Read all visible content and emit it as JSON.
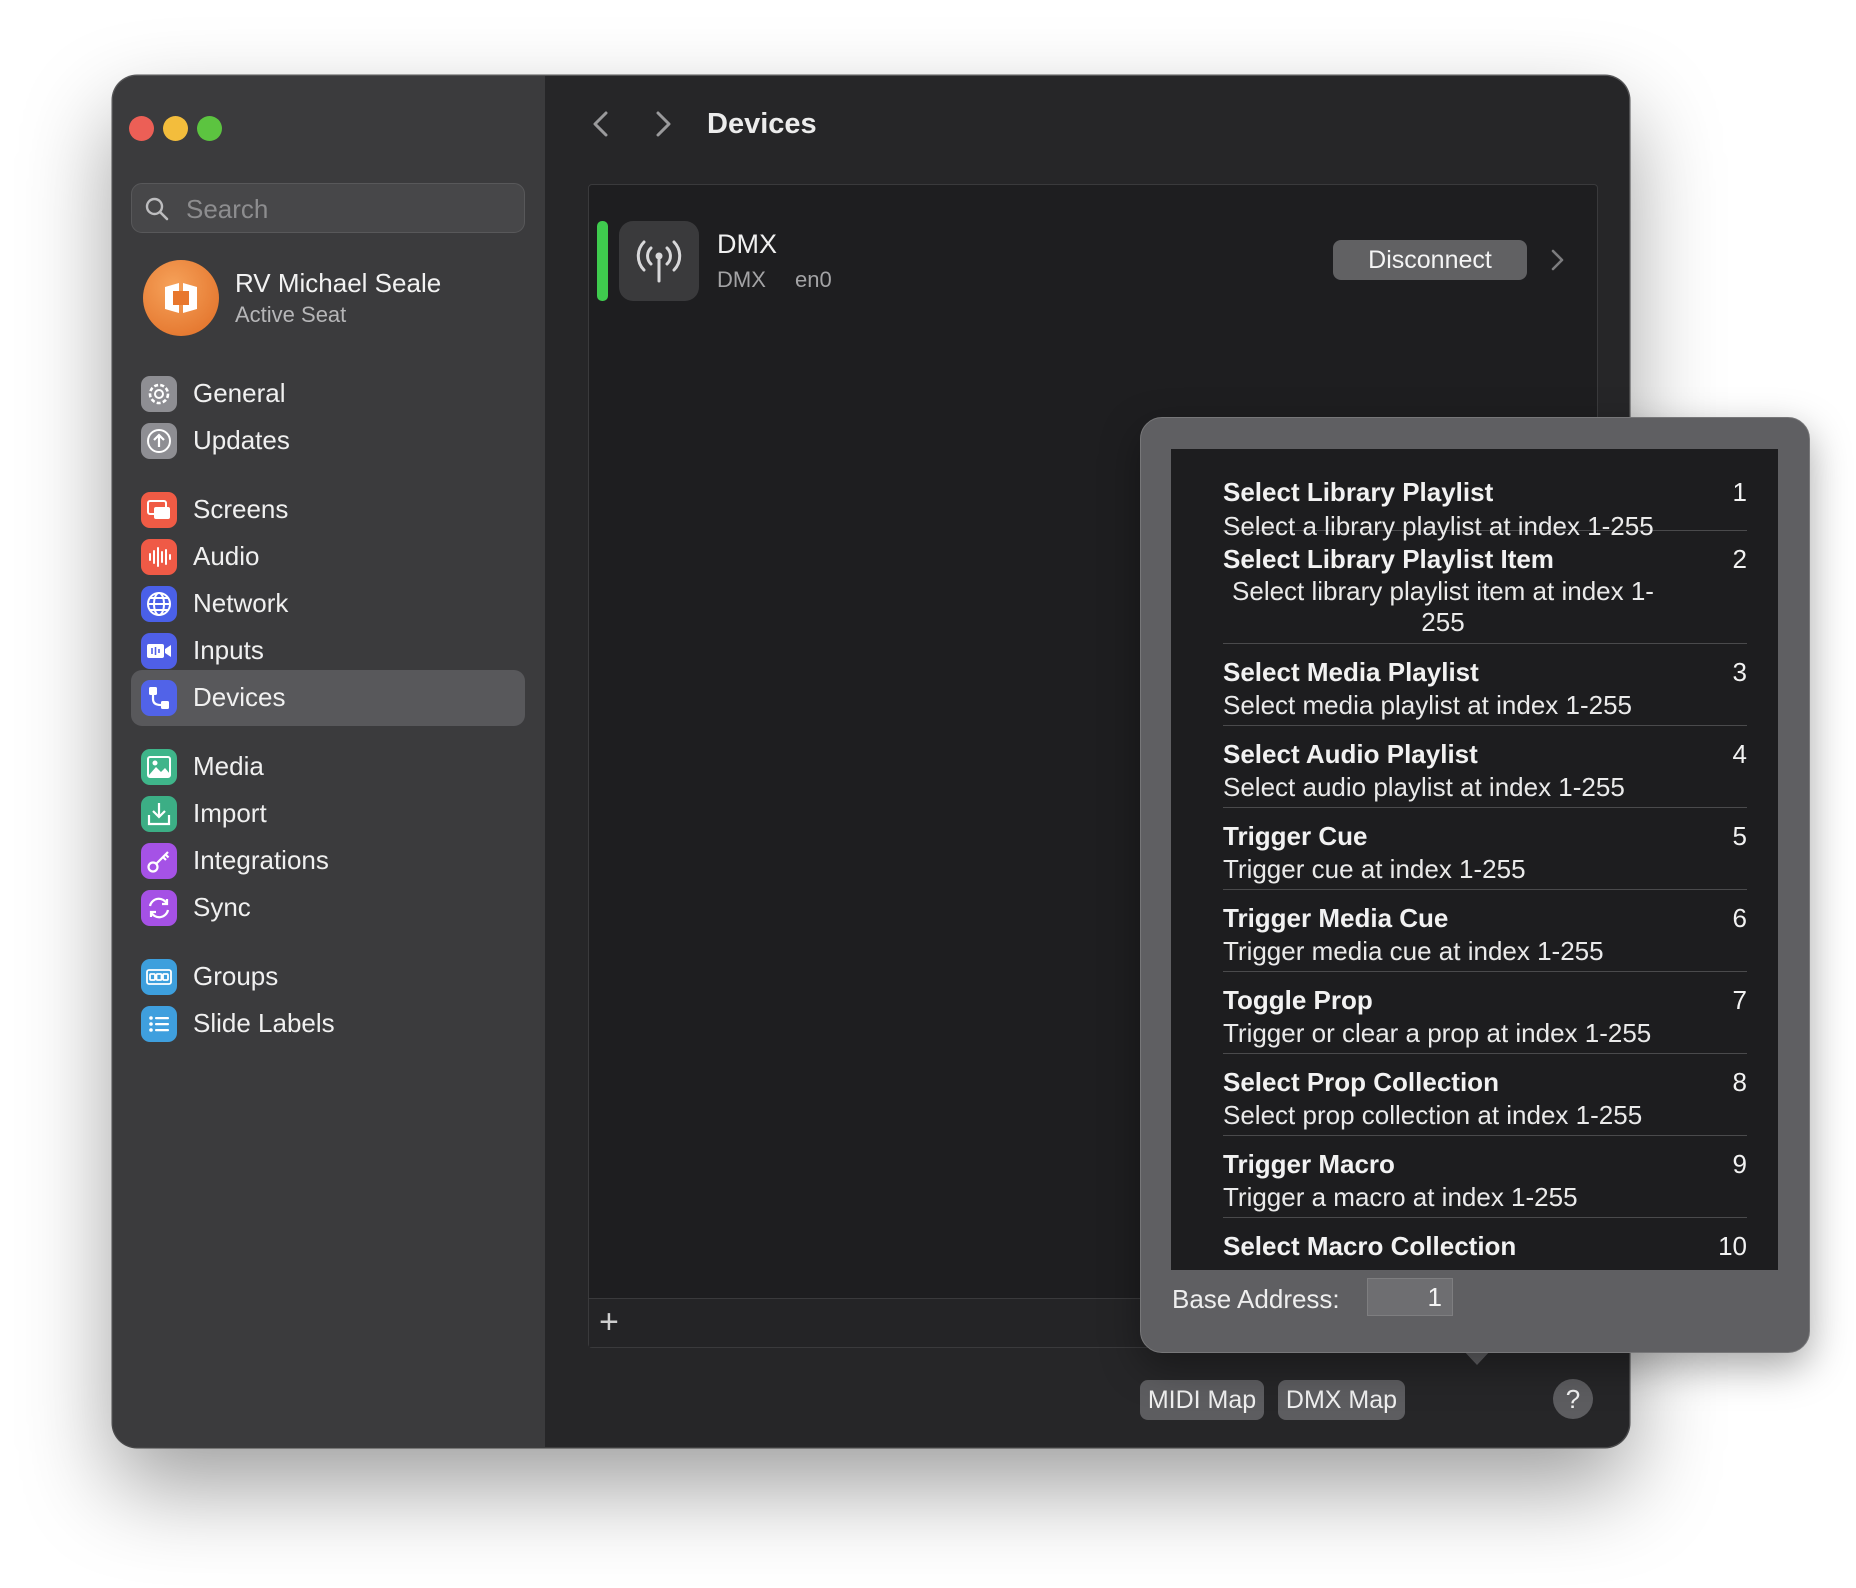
{
  "colors": {
    "close": "#ec5f56",
    "minimize": "#f3bd3c",
    "zoom": "#5cc440",
    "status_connected": "#3fcb4e"
  },
  "sidebar": {
    "search_placeholder": "Search",
    "account": {
      "name": "RV Michael Seale",
      "subtitle": "Active Seat"
    },
    "items": [
      {
        "label": "General",
        "icon": "gear-icon",
        "color": "#8e8e93"
      },
      {
        "label": "Updates",
        "icon": "arrow-up-circle-icon",
        "color": "#8e8e93"
      },
      {
        "label": "Screens",
        "icon": "screens-icon",
        "color": "#f05b45"
      },
      {
        "label": "Audio",
        "icon": "waveform-icon",
        "color": "#ef5a46"
      },
      {
        "label": "Network",
        "icon": "globe-icon",
        "color": "#4a60e8"
      },
      {
        "label": "Inputs",
        "icon": "video-input-icon",
        "color": "#4f5fe7"
      },
      {
        "label": "Devices",
        "icon": "devices-icon",
        "color": "#5163e8"
      },
      {
        "label": "Media",
        "icon": "photo-icon",
        "color": "#3fb58a"
      },
      {
        "label": "Import",
        "icon": "import-icon",
        "color": "#3cae85"
      },
      {
        "label": "Integrations",
        "icon": "key-icon",
        "color": "#a552e6"
      },
      {
        "label": "Sync",
        "icon": "sync-icon",
        "color": "#a551e5"
      },
      {
        "label": "Groups",
        "icon": "groups-icon",
        "color": "#3d9fdd"
      },
      {
        "label": "Slide Labels",
        "icon": "list-icon",
        "color": "#3f9fde"
      }
    ]
  },
  "header": {
    "title": "Devices"
  },
  "device": {
    "name": "DMX",
    "type": "DMX",
    "interface": "en0",
    "action_label": "Disconnect",
    "icon": "antenna-icon"
  },
  "footer": {
    "add_label": "+",
    "midi_map_label": "MIDI Map",
    "dmx_map_label": "DMX Map",
    "help_label": "?"
  },
  "dmx_map": {
    "entries": [
      {
        "title": "Select Library Playlist",
        "description": "Select a library playlist at index 1-255",
        "channel": "1"
      },
      {
        "title": "Select Library Playlist Item",
        "description": "Select library playlist item at index 1-255",
        "channel": "2"
      },
      {
        "title": "Select Media Playlist",
        "description": "Select media playlist at index 1-255",
        "channel": "3"
      },
      {
        "title": "Select Audio Playlist",
        "description": "Select audio playlist at index 1-255",
        "channel": "4"
      },
      {
        "title": "Trigger Cue",
        "description": "Trigger cue at index 1-255",
        "channel": "5"
      },
      {
        "title": "Trigger Media Cue",
        "description": "Trigger media cue at index 1-255",
        "channel": "6"
      },
      {
        "title": "Toggle Prop",
        "description": "Trigger or clear a prop at index 1-255",
        "channel": "7"
      },
      {
        "title": "Select Prop Collection",
        "description": "Select prop collection at index 1-255",
        "channel": "8"
      },
      {
        "title": "Trigger Macro",
        "description": "Trigger a macro at index 1-255",
        "channel": "9"
      },
      {
        "title": "Select Macro Collection",
        "description": "",
        "channel": "10"
      }
    ],
    "base_address_label": "Base Address:",
    "base_address_value": "1"
  }
}
